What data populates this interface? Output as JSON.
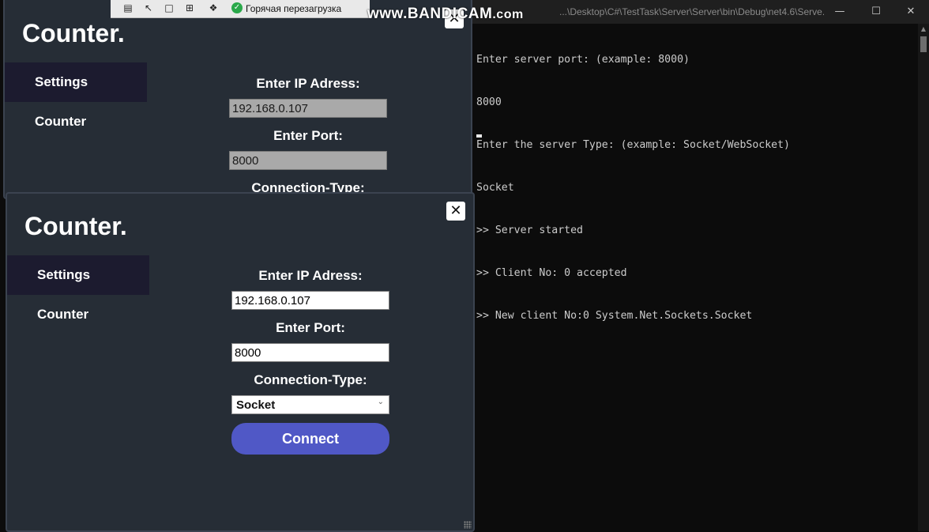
{
  "toolbar": {
    "hot_reload_label": "Горячая перезагрузка",
    "icons": [
      "live-visual-tree-icon",
      "select-element-icon",
      "display-layout-icon",
      "track-focus-icon",
      "hot-reload-signal-icon"
    ]
  },
  "watermark": {
    "main": "www.BANDICAM",
    "suffix": ".com"
  },
  "console": {
    "title": "...\\Desktop\\C#\\TestTask\\Server\\Server\\bin\\Debug\\net4.6\\Serve...",
    "lines": [
      "Enter server port: (example: 8000)",
      "8000",
      "Enter the server Type: (example: Socket/WebSocket)",
      "Socket",
      ">> Server started",
      ">> Client No: 0 accepted",
      ">> New client No:0 System.Net.Sockets.Socket"
    ]
  },
  "app_back": {
    "brand": "Counter.",
    "nav": {
      "settings": "Settings",
      "counter": "Counter"
    },
    "ip_label": "Enter IP Adress:",
    "ip_value": "192.168.0.107",
    "port_label": "Enter Port:",
    "port_value": "8000",
    "conn_label": "Connection-Type:"
  },
  "app_front": {
    "brand": "Counter.",
    "close": "✕",
    "nav": {
      "settings": "Settings",
      "counter": "Counter"
    },
    "ip_label": "Enter IP Adress:",
    "ip_value": "192.168.0.107",
    "port_label": "Enter Port:",
    "port_value": "8000",
    "conn_label": "Connection-Type:",
    "conn_selected": "Socket",
    "connect_label": "Connect"
  },
  "colors": {
    "app_bg": "#262d36",
    "nav_active": "#1c1b2f",
    "connect_button": "#5058c6",
    "console_bg": "#0c0c0c",
    "console_text": "#cccccc"
  }
}
